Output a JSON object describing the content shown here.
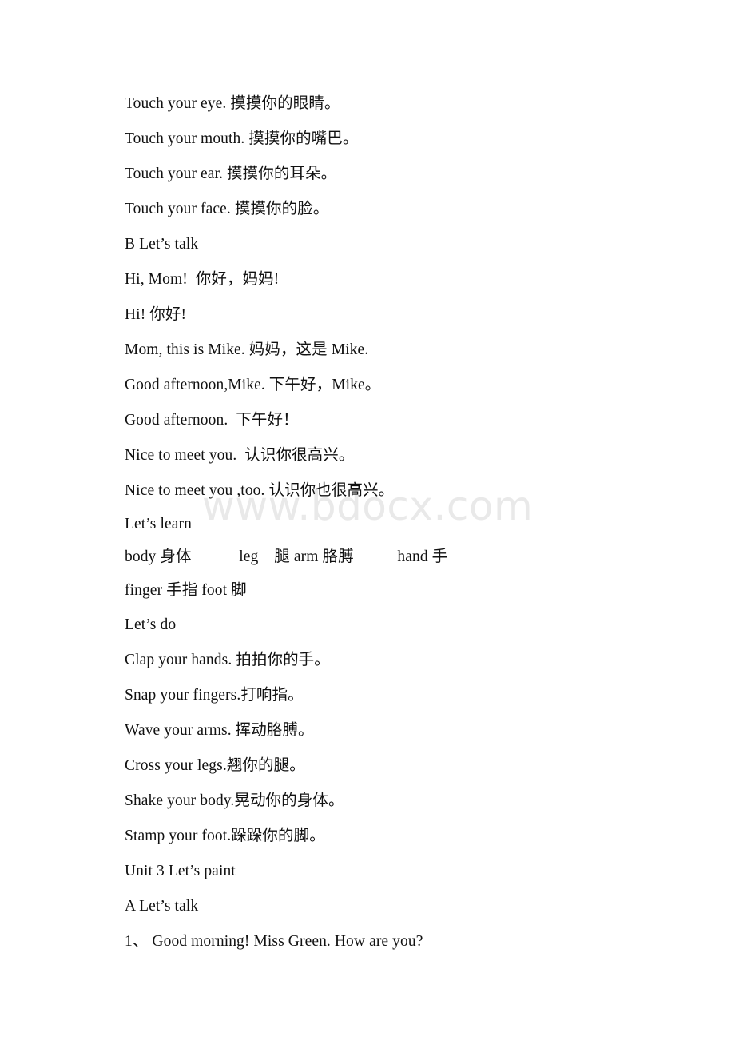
{
  "page": {
    "background_color": "#ffffff",
    "text_color": "#111111"
  },
  "watermark": {
    "text": "www.bdocx.com",
    "color": "#e9e9e9"
  },
  "document": {
    "lines": [
      {
        "id": "touch-eye",
        "text": "Touch your eye. 摸摸你的眼睛。"
      },
      {
        "id": "touch-mouth",
        "text": "Touch your mouth. 摸摸你的嘴巴。"
      },
      {
        "id": "touch-ear",
        "text": "Touch your ear. 摸摸你的耳朵。"
      },
      {
        "id": "touch-face",
        "text": "Touch your face. 摸摸你的脸。"
      },
      {
        "id": "section-b-lets-talk",
        "text": "B Let’s talk"
      },
      {
        "id": "hi-mom",
        "text": "Hi, Mom!  你好，妈妈!"
      },
      {
        "id": "hi",
        "text": "Hi! 你好!"
      },
      {
        "id": "mom-this-is-mike",
        "text": "Mom, this is Mike. 妈妈，这是 Mike."
      },
      {
        "id": "good-afternoon-mike",
        "text": "Good afternoon,Mike. 下午好，Mike。"
      },
      {
        "id": "good-afternoon",
        "text": "Good afternoon.  下午好！"
      },
      {
        "id": "nice-to-meet-you",
        "text": "Nice to meet you.  认识你很高兴。"
      },
      {
        "id": "nice-to-meet-you-too",
        "text": "Nice to meet you ,too. 认识你也很高兴。"
      },
      {
        "id": "lets-learn",
        "text": "Let’s learn"
      },
      {
        "id": "vocab-row-1",
        "text": "body 身体            leg    腿 arm 胳膊           hand 手"
      },
      {
        "id": "vocab-row-2",
        "text": "finger 手指 foot 脚"
      },
      {
        "id": "lets-do",
        "text": "Let’s do"
      },
      {
        "id": "clap-hands",
        "text": "Clap your hands. 拍拍你的手。"
      },
      {
        "id": "snap-fingers",
        "text": "Snap your fingers.打响指。"
      },
      {
        "id": "wave-arms",
        "text": "Wave your arms. 挥动胳膊。"
      },
      {
        "id": "cross-legs",
        "text": "Cross your legs.翘你的腿。"
      },
      {
        "id": "shake-body",
        "text": "Shake your body.晃动你的身体。"
      },
      {
        "id": "stamp-foot",
        "text": "Stamp your foot.跺跺你的脚。"
      },
      {
        "id": "unit-3-heading",
        "text": "Unit 3 Let’s paint"
      },
      {
        "id": "section-a-lets-talk",
        "text": "A Let’s talk"
      },
      {
        "id": "question-1",
        "text": "1、 Good morning! Miss Green. How are you?"
      }
    ]
  }
}
